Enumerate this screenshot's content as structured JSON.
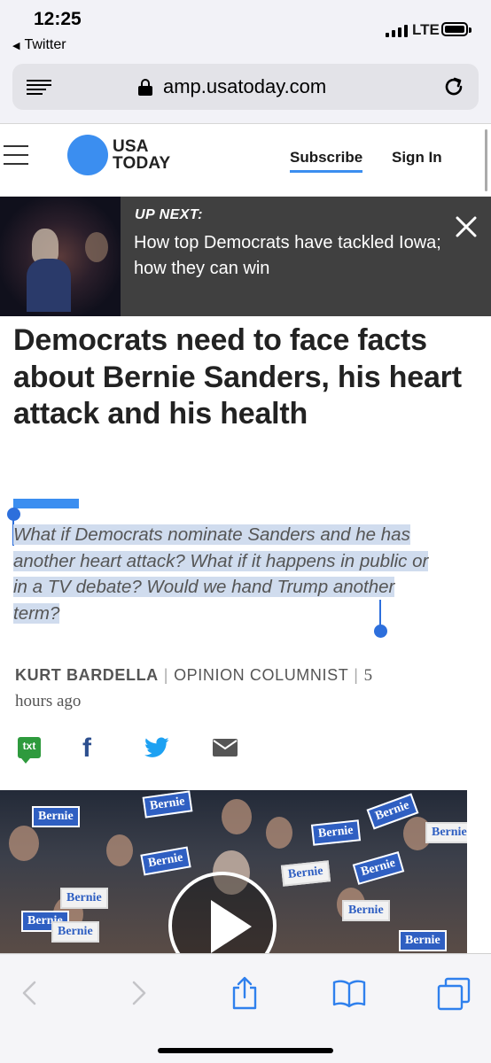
{
  "status_bar": {
    "time": "12:25",
    "back_app": "Twitter",
    "network": "LTE"
  },
  "browser": {
    "url": "amp.usatoday.com"
  },
  "site_header": {
    "logo_line1": "USA",
    "logo_line2": "TODAY",
    "subscribe": "Subscribe",
    "sign_in": "Sign In",
    "brand_color": "#3b8ef0"
  },
  "up_next": {
    "label": "UP NEXT:",
    "title": "How top Democrats have tackled Iowa; how they can win"
  },
  "article": {
    "headline": "Democrats need to face facts about Bernie Sanders, his heart attack and his health",
    "quote": "What if Democrats nominate Sanders and he has another heart attack? What if it happens in public or in a TV debate? Would we hand Trump another term?",
    "author": "KURT BARDELLA",
    "role": "OPINION COLUMNIST",
    "time_ago_1": "5",
    "time_ago_2": "hours ago"
  },
  "share": {
    "txt_label": "txt",
    "facebook_glyph": "f"
  },
  "video": {
    "sign_text": "Bernie"
  }
}
